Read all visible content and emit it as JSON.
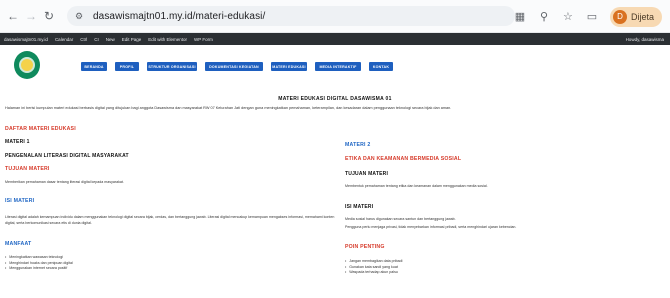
{
  "browser": {
    "url": "dasawismajtn01.my.id/materi-edukasi/",
    "profile_name": "Dijeta",
    "profile_initial": "D"
  },
  "bookmarks": {
    "items": [
      "dasawismajtn01.my.id",
      "Calendar",
      "Ctrl",
      "CI",
      "New",
      "Edit Page",
      "Edit with Elementor",
      "WP Form"
    ],
    "right": "Howdy, dasawisma"
  },
  "site": {
    "menu": [
      "BERANDA",
      "PROFIL",
      "STRUKTUR ORGANISASI",
      "DOKUMENTASI KEGIATAN",
      "MATERI EDUKASI",
      "MEDIA INTERAKTIF",
      "KONTAK"
    ]
  },
  "page": {
    "title": "MATERI EDUKASI DIGITAL DASAWISMA 01",
    "intro": "Halaman ini berisi kumpulan materi edukasi berbasis digital yang ditujukan bagi anggota Dasawisma dan masyarakat RW 07 Kelurahan Jati dengan guna meningkatkan pemahaman, keterampilan, dan kesadaran dalam penggunaan teknologi secara bijak dan aman.",
    "left": {
      "list_heading": "DAFTAR MATERI EDUKASI",
      "materi_label": "MATERI 1",
      "materi_title": "PENGENALAN LITERASI DIGITAL MASYARAKAT",
      "tujuan_heading": "TUJUAN MATERI",
      "tujuan_text": "Memberikan pemahaman dasar tentang literasi digital kepada masyarakat.",
      "isi_heading": "ISI MATERI",
      "isi_text": "Literasi digital adalah kemampuan individu dalam menggunakan teknologi digital secara bijak, cerdas, dan bertanggung jawab. Literasi digital mencakup kemampuan mengakses informasi, memahami konten digital, serta berkomunikasi secara etis di dunia digital.",
      "manfaat_heading": "MANFAAT",
      "manfaat_items": [
        "Meningkatkan wawasan teknologi",
        "Menghindari hoaks dan penipuan digital",
        "Menggunakan internet secara positif"
      ]
    },
    "right": {
      "materi_label": "MATERI 2",
      "materi_title": "ETIKA DAN KEAMANAN BERMEDIA SOSIAL",
      "tujuan_heading": "TUJUAN MATERI",
      "tujuan_text": "Membentuk pemahaman tentang etika dan keamanan dalam menggunakan media sosial.",
      "isi_heading": "ISI MATERI",
      "isi_text_1": "Media sosial harus digunakan secara santun dan bertanggung jawab.",
      "isi_text_2": "Pengguna perlu menjaga privasi, tidak menyebarkan informasi pribadi, serta menghindari ujaran kebencian.",
      "poin_heading": "POIN PENTING",
      "poin_items": [
        "Jangan membagikan data pribadi",
        "Gunakan kata sandi yang kuat",
        "Waspada terhadap akun palsu"
      ]
    }
  },
  "colors": {
    "menu_button": "#1e5fbf",
    "red_heading": "#d63a2a",
    "blue_heading": "#1f66c4",
    "bookmarks_bar": "#2b2f33"
  }
}
